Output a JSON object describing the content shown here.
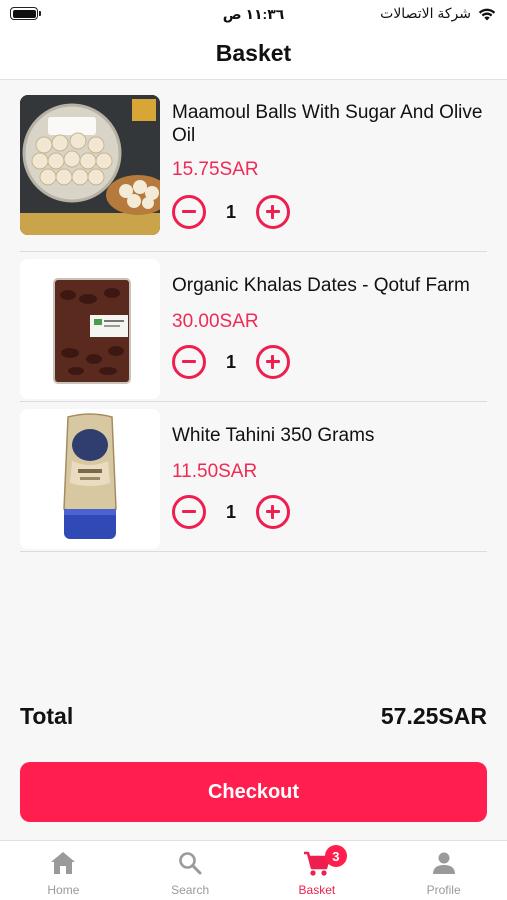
{
  "status_bar": {
    "time": "١١:٣٦ ص",
    "carrier": "شركة الاتصالات"
  },
  "header": {
    "title": "Basket"
  },
  "items": [
    {
      "name": "Maamoul Balls With Sugar And Olive Oil",
      "price": "15.75SAR",
      "quantity": "1",
      "image": "maamoul-box"
    },
    {
      "name": "Organic Khalas Dates - Qotuf Farm",
      "price": "30.00SAR",
      "quantity": "1",
      "image": "dates-pack"
    },
    {
      "name": "White Tahini 350 Grams",
      "price": "11.50SAR",
      "quantity": "1",
      "image": "tahini-bottle"
    }
  ],
  "summary": {
    "total_label": "Total",
    "total_value": "57.25SAR"
  },
  "checkout": {
    "label": "Checkout"
  },
  "tabs": [
    {
      "label": "Home",
      "icon": "home-icon",
      "active": false
    },
    {
      "label": "Search",
      "icon": "search-icon",
      "active": false
    },
    {
      "label": "Basket",
      "icon": "cart-icon",
      "active": true,
      "badge": "3"
    },
    {
      "label": "Profile",
      "icon": "profile-icon",
      "active": false
    }
  ],
  "colors": {
    "accent": "#ff1e4d",
    "price": "#ee2b57",
    "inactive": "#9a9a9a"
  }
}
